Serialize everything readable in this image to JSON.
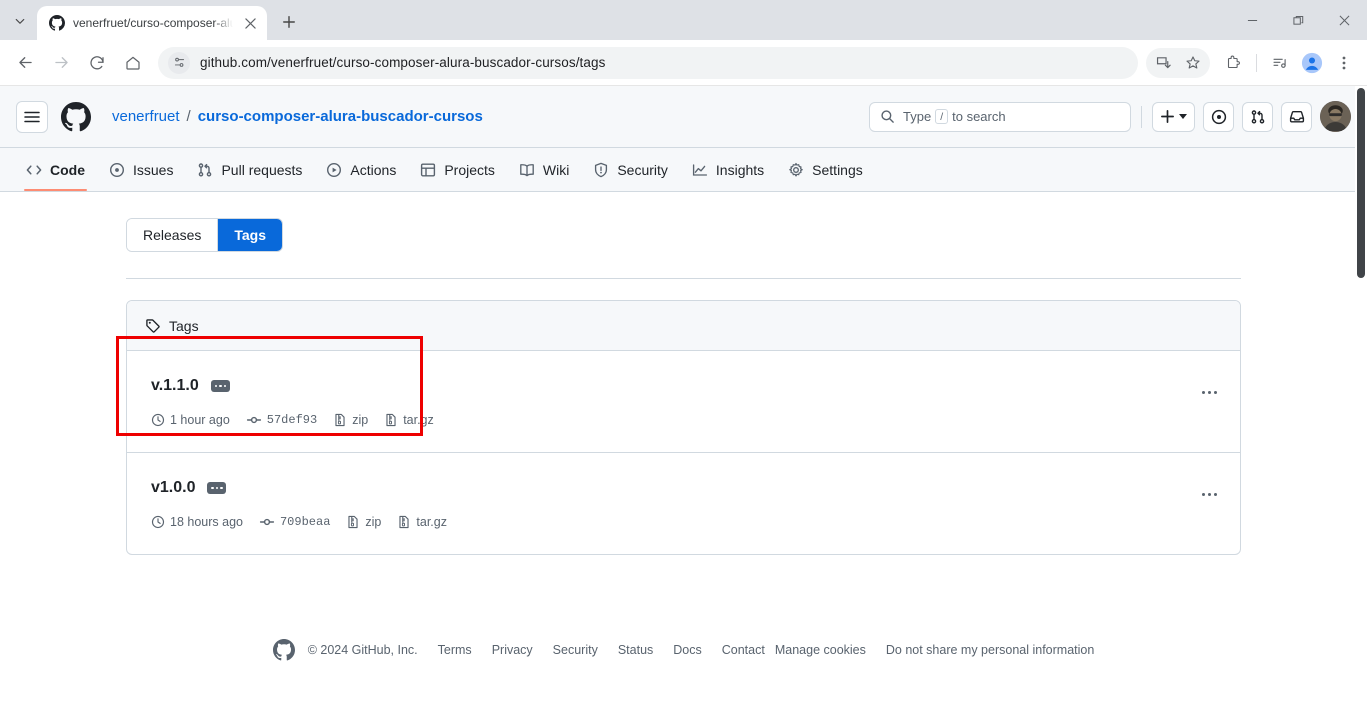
{
  "browser": {
    "tab": {
      "title": "venerfruet/curso-composer-alu",
      "favicon": "github-icon"
    },
    "new_tab_label": "+",
    "url": "github.com/venerfruet/curso-composer-alura-buscador-cursos/tags",
    "window_controls": {
      "minimize": "minimize-icon",
      "maximize": "restore-icon",
      "close": "close-icon"
    },
    "toolbar_icons": [
      "install-icon",
      "bookmark-star-icon",
      "extensions-icon",
      "media-control-icon",
      "profile-icon",
      "chrome-menu-icon"
    ],
    "nav_icons": [
      "back-arrow-icon",
      "forward-arrow-icon",
      "reload-icon",
      "home-icon",
      "site-settings-icon"
    ]
  },
  "gh_header": {
    "menu_icon": "hamburger-icon",
    "logo": "github-mark-icon",
    "breadcrumb": {
      "owner": "venerfruet",
      "separator": "/",
      "repo": "curso-composer-alura-buscador-cursos"
    },
    "search": {
      "prefix": "Type",
      "key": "/",
      "suffix": "to search",
      "placeholder": "Type / to search"
    },
    "create_new_label": "+",
    "icons": [
      "issues-icon",
      "pull-requests-icon",
      "inbox-icon",
      "user-avatar"
    ]
  },
  "repo_nav": {
    "tabs": [
      {
        "label": "Code",
        "icon": "code-icon",
        "active": true
      },
      {
        "label": "Issues",
        "icon": "issue-opened-icon",
        "active": false
      },
      {
        "label": "Pull requests",
        "icon": "git-pull-request-icon",
        "active": false
      },
      {
        "label": "Actions",
        "icon": "play-icon",
        "active": false
      },
      {
        "label": "Projects",
        "icon": "table-icon",
        "active": false
      },
      {
        "label": "Wiki",
        "icon": "book-icon",
        "active": false
      },
      {
        "label": "Security",
        "icon": "shield-icon",
        "active": false
      },
      {
        "label": "Insights",
        "icon": "graph-icon",
        "active": false
      },
      {
        "label": "Settings",
        "icon": "gear-icon",
        "active": false
      }
    ]
  },
  "main": {
    "segmented": {
      "releases_label": "Releases",
      "tags_label": "Tags",
      "selected": "Tags"
    },
    "panel": {
      "icon": "tag-icon",
      "title": "Tags"
    },
    "tags": [
      {
        "name": "v.1.1.0",
        "badge": "verified-ellipsis-badge",
        "time": "1 hour ago",
        "commit": "57def93",
        "zip_label": "zip",
        "targz_label": "tar.gz",
        "menu": "kebab-menu-icon",
        "highlighted": true
      },
      {
        "name": "v1.0.0",
        "badge": "verified-ellipsis-badge",
        "time": "18 hours ago",
        "commit": "709beaa",
        "zip_label": "zip",
        "targz_label": "tar.gz",
        "menu": "kebab-menu-icon",
        "highlighted": false
      }
    ]
  },
  "footer": {
    "logo": "github-mark-icon",
    "copyright": "© 2024 GitHub, Inc.",
    "links": [
      "Terms",
      "Privacy",
      "Security",
      "Status",
      "Docs",
      "Contact",
      "Manage cookies",
      "Do not share my personal information"
    ]
  },
  "colors": {
    "accent_blue": "#0969da",
    "active_tab_underline": "#fd8c73",
    "annotation_red": "#ee0000",
    "header_bg": "#f6f8fa",
    "border": "#d1d9e0",
    "muted_text": "#59636e"
  }
}
